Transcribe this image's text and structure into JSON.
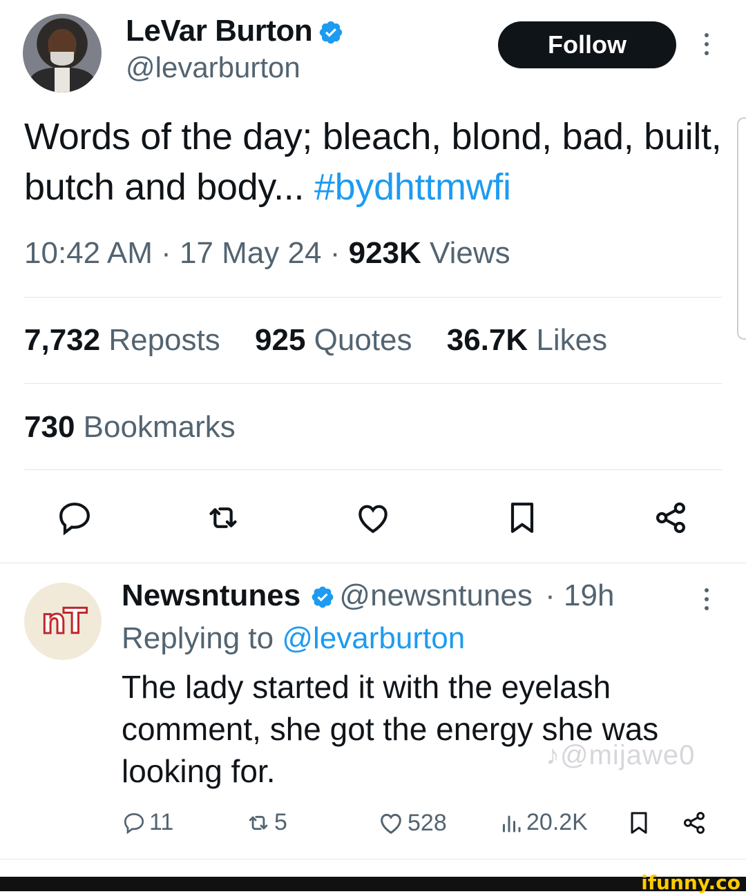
{
  "tweet": {
    "author_name": "LeVar Burton",
    "author_handle": "@levarburton",
    "follow_label": "Follow",
    "text": "Words of the day; bleach, blond, bad, built, butch and body...",
    "hashtag": "#bydhttmwfi",
    "time": "10:42 AM",
    "date": "17 May 24",
    "views_count": "923K",
    "views_label": "Views",
    "reposts_count": "7,732",
    "reposts_label": "Reposts",
    "quotes_count": "925",
    "quotes_label": "Quotes",
    "likes_count": "36.7K",
    "likes_label": "Likes",
    "bookmarks_count": "730",
    "bookmarks_label": "Bookmarks"
  },
  "reply": {
    "author_name": "Newsntunes",
    "author_handle": "@newsntunes",
    "age": "19h",
    "avatar_text": "nT",
    "replying_prefix": "Replying to",
    "replying_handle": "@levarburton",
    "text": "The lady started it with the eyelash comment, she got the energy she was looking for.",
    "replies": "11",
    "reposts": "5",
    "likes": "528",
    "views": "20.2K"
  },
  "overlay": {
    "watermark": "♪@mijawe0",
    "site_mark": "ifunny.co"
  },
  "icons": [
    "verified-badge-icon",
    "more-icon",
    "reply-icon",
    "repost-icon",
    "like-icon",
    "bookmark-icon",
    "share-icon",
    "views-icon",
    "tiktok-icon"
  ],
  "colors": {
    "accent": "#1d9bf0",
    "text": "#0f1419",
    "muted": "#536471",
    "ifunny": "#ffcc00"
  }
}
